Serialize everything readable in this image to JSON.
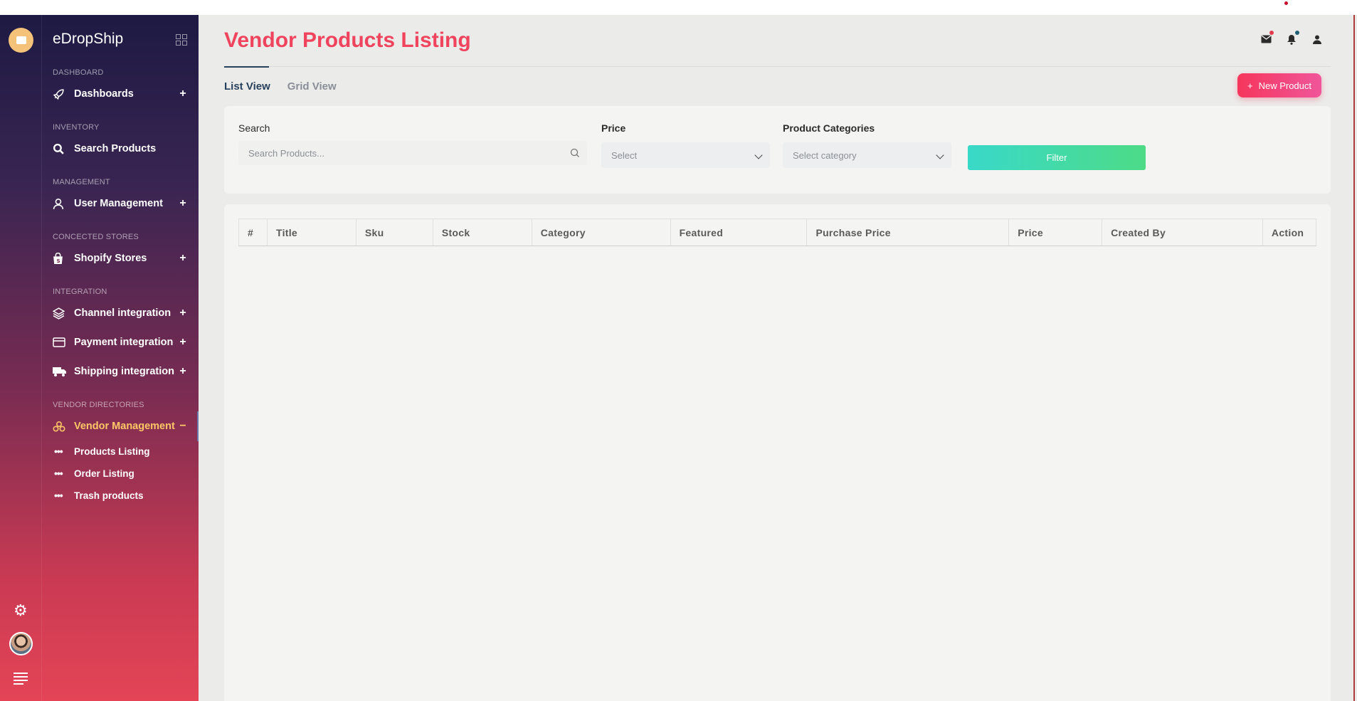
{
  "app": {
    "brand": "eDropShip"
  },
  "sidebar": {
    "sections": {
      "dashboard": "DASHBOARD",
      "inventory": "INVENTORY",
      "management": "MANAGEMENT",
      "stores": "CONCECTED STORES",
      "integration": "INTEGRATION",
      "vendor": "VENDOR DIRECTORIES"
    },
    "items": {
      "dashboards": "Dashboards",
      "search_products": "Search Products",
      "user_management": "User Management",
      "shopify_stores": "Shopify Stores",
      "channel_integration": "Channel integration",
      "payment_integration": "Payment integration",
      "shipping_integration": "Shipping integration",
      "vendor_management": "Vendor Management"
    },
    "sub_items": {
      "products_listing": "Products Listing",
      "order_listing": "Order Listing",
      "trash_products": "Trash products"
    },
    "plus": "+",
    "minus": "−",
    "dots": "•••"
  },
  "header": {
    "title": "Vendor Products Listing"
  },
  "tabs": {
    "list": "List View",
    "grid": "Grid View"
  },
  "actions": {
    "new_product": "New Product",
    "new_product_icon": "+"
  },
  "filters": {
    "search_label": "Search",
    "search_placeholder": "Search Products...",
    "price_label": "Price",
    "price_value": "Select",
    "category_label": "Product Categories",
    "category_value": "Select category",
    "filter_button": "Filter"
  },
  "table": {
    "columns": [
      "#",
      "Title",
      "Sku",
      "Stock",
      "Category",
      "Featured",
      "Purchase Price",
      "Price",
      "Created By",
      "Action"
    ]
  },
  "colors": {
    "accent": "#f0445e",
    "brand_gold": "#ffc766",
    "filter_start": "#39d9c9",
    "filter_end": "#4ddb87"
  }
}
